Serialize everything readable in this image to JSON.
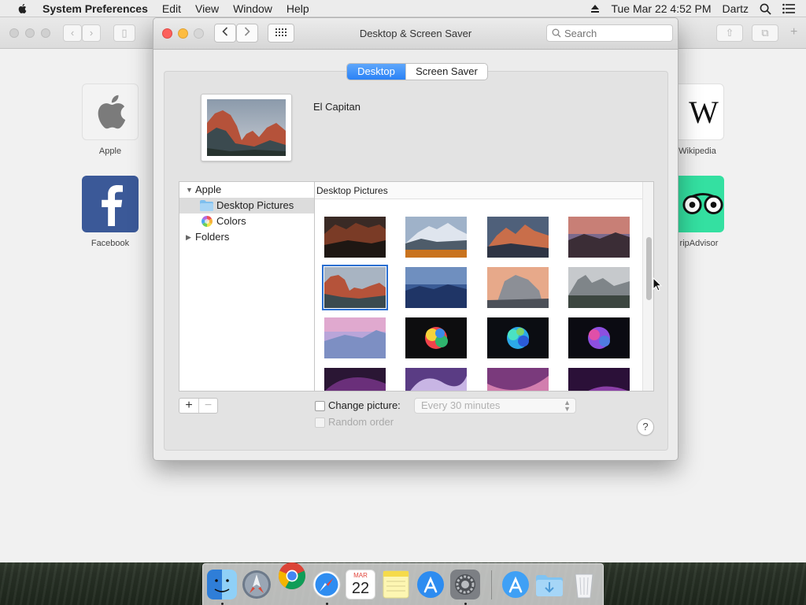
{
  "menubar": {
    "app_name": "System Preferences",
    "menus": [
      "Edit",
      "View",
      "Window",
      "Help"
    ],
    "clock": "Tue Mar 22  4:52 PM",
    "user": "Dartz"
  },
  "background_browser": {
    "tiles": [
      {
        "label": "Apple"
      },
      {
        "label": "Facebook"
      },
      {
        "label": "Wikipedia"
      },
      {
        "label": "ripAdvisor"
      }
    ]
  },
  "window": {
    "title": "Desktop & Screen Saver",
    "search_placeholder": "Search",
    "tabs": [
      {
        "label": "Desktop",
        "active": true
      },
      {
        "label": "Screen Saver",
        "active": false
      }
    ],
    "current_picture_name": "El Capitan",
    "sources": [
      {
        "label": "Apple",
        "expanded": true
      },
      {
        "label": "Desktop Pictures",
        "selected": true
      },
      {
        "label": "Colors"
      },
      {
        "label": "Folders",
        "expanded": false
      }
    ],
    "grid_header": "Desktop Pictures",
    "add_label": "+",
    "remove_label": "−",
    "change_picture_label": "Change picture:",
    "change_picture_checked": false,
    "interval_value": "Every 30 minutes",
    "random_order_label": "Random order",
    "help_label": "?"
  },
  "dock": {
    "date_month": "MAR",
    "date_day": "22"
  },
  "colors": {
    "accent": "#2a82f6",
    "close": "#fc605c",
    "minimize": "#fdbc40"
  }
}
